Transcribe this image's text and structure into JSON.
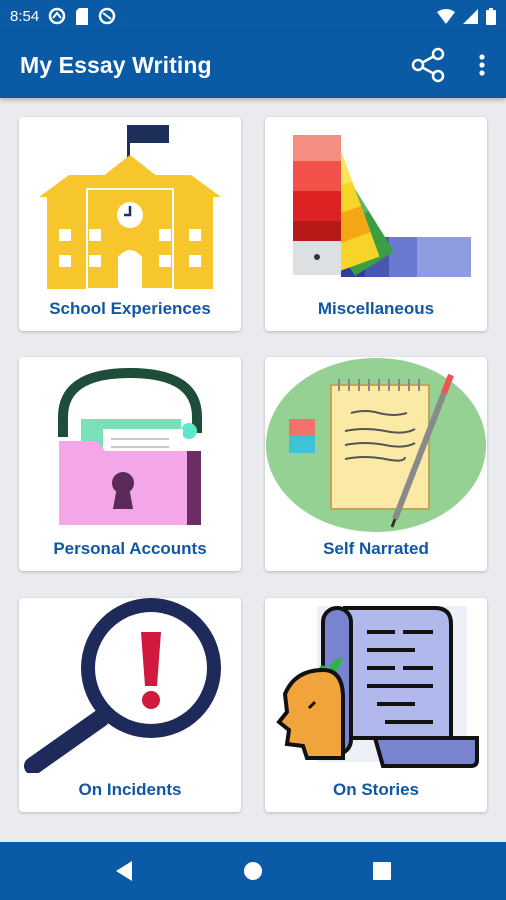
{
  "status_bar": {
    "time": "8:54",
    "left_icons": [
      "circle-cast-icon",
      "sd-card-icon",
      "circle-cast-icon"
    ],
    "right_icons": [
      "wifi-icon",
      "cellular-signal-icon",
      "battery-icon"
    ]
  },
  "app_bar": {
    "title": "My Essay Writing",
    "actions": [
      "share-icon",
      "more-vert-icon"
    ]
  },
  "categories": [
    {
      "label": "School Experiences",
      "icon": "school-building-icon"
    },
    {
      "label": "Miscellaneous",
      "icon": "color-swatches-icon"
    },
    {
      "label": "Personal Accounts",
      "icon": "locked-folder-icon"
    },
    {
      "label": "Self Narrated",
      "icon": "notepad-pencil-icon"
    },
    {
      "label": "On Incidents",
      "icon": "magnifier-exclamation-icon"
    },
    {
      "label": "On Stories",
      "icon": "scroll-head-icon"
    }
  ],
  "nav_bar": {
    "buttons": [
      "back-icon",
      "home-icon",
      "recents-icon"
    ]
  },
  "colors": {
    "primary": "#0a5aa6",
    "label": "#1257a3",
    "background": "#e9ebee"
  }
}
